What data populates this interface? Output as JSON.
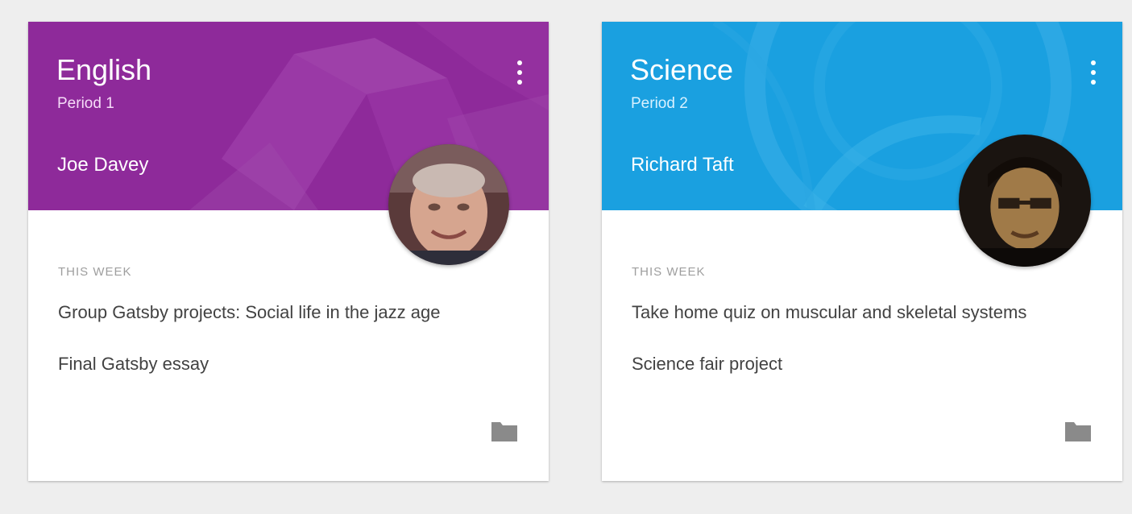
{
  "cards": [
    {
      "title": "English",
      "period": "Period 1",
      "teacher": "Joe Davey",
      "section_label": "THIS WEEK",
      "assignments": [
        "Group Gatsby projects: Social life in the jazz age",
        "Final Gatsby essay"
      ],
      "header_color": "#8e2a9a",
      "icons": {
        "menu": "more-vert-icon",
        "folder": "folder-icon"
      }
    },
    {
      "title": "Science",
      "period": "Period 2",
      "teacher": "Richard Taft",
      "section_label": "THIS WEEK",
      "assignments": [
        "Take home quiz on muscular and skeletal systems",
        "Science fair project"
      ],
      "header_color": "#1aa0e0",
      "icons": {
        "menu": "more-vert-icon",
        "folder": "folder-icon"
      }
    }
  ]
}
